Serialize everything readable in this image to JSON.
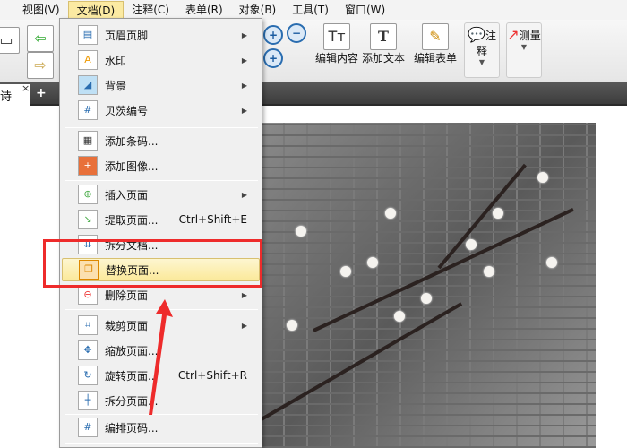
{
  "menubar": {
    "items": [
      "视图(V)",
      "文档(D)",
      "注释(C)",
      "表单(R)",
      "对象(B)",
      "工具(T)",
      "窗口(W)"
    ],
    "active": "文档(D)"
  },
  "toolbar": {
    "edit_content": "编辑内容",
    "add_text": "添加文本",
    "edit_form": "编辑表单",
    "annotate": "注释",
    "measure": "测量"
  },
  "tab": {
    "title": "诗",
    "close": "×",
    "add": "+"
  },
  "menu": {
    "items": [
      {
        "label": "页眉页脚",
        "icon": "header-footer-icon",
        "submenu": true
      },
      {
        "label": "水印",
        "icon": "watermark-icon",
        "submenu": true
      },
      {
        "label": "背景",
        "icon": "background-icon",
        "submenu": true
      },
      {
        "label": "贝茨编号",
        "icon": "bates-number-icon",
        "submenu": true
      },
      {
        "label": "添加条码...",
        "icon": "barcode-icon"
      },
      {
        "label": "添加图像...",
        "icon": "add-image-icon"
      },
      {
        "label": "插入页面",
        "icon": "insert-page-icon",
        "submenu": true
      },
      {
        "label": "提取页面...",
        "icon": "extract-page-icon",
        "shortcut": "Ctrl+Shift+E"
      },
      {
        "label": "拆分文档...",
        "icon": "split-document-icon"
      },
      {
        "label": "替换页面...",
        "icon": "replace-page-icon",
        "highlighted": true
      },
      {
        "label": "删除页面",
        "icon": "delete-page-icon",
        "submenu": true
      },
      {
        "label": "裁剪页面",
        "icon": "crop-page-icon",
        "submenu": true
      },
      {
        "label": "缩放页面...",
        "icon": "scale-page-icon"
      },
      {
        "label": "旋转页面...",
        "icon": "rotate-page-icon",
        "shortcut": "Ctrl+Shift+R"
      },
      {
        "label": "拆分页面...",
        "icon": "split-page-icon"
      },
      {
        "label": "编排页码...",
        "icon": "page-numbering-icon"
      }
    ]
  },
  "colors": {
    "highlight": "#fbe99a",
    "annotation_red": "#ee2b2b"
  }
}
